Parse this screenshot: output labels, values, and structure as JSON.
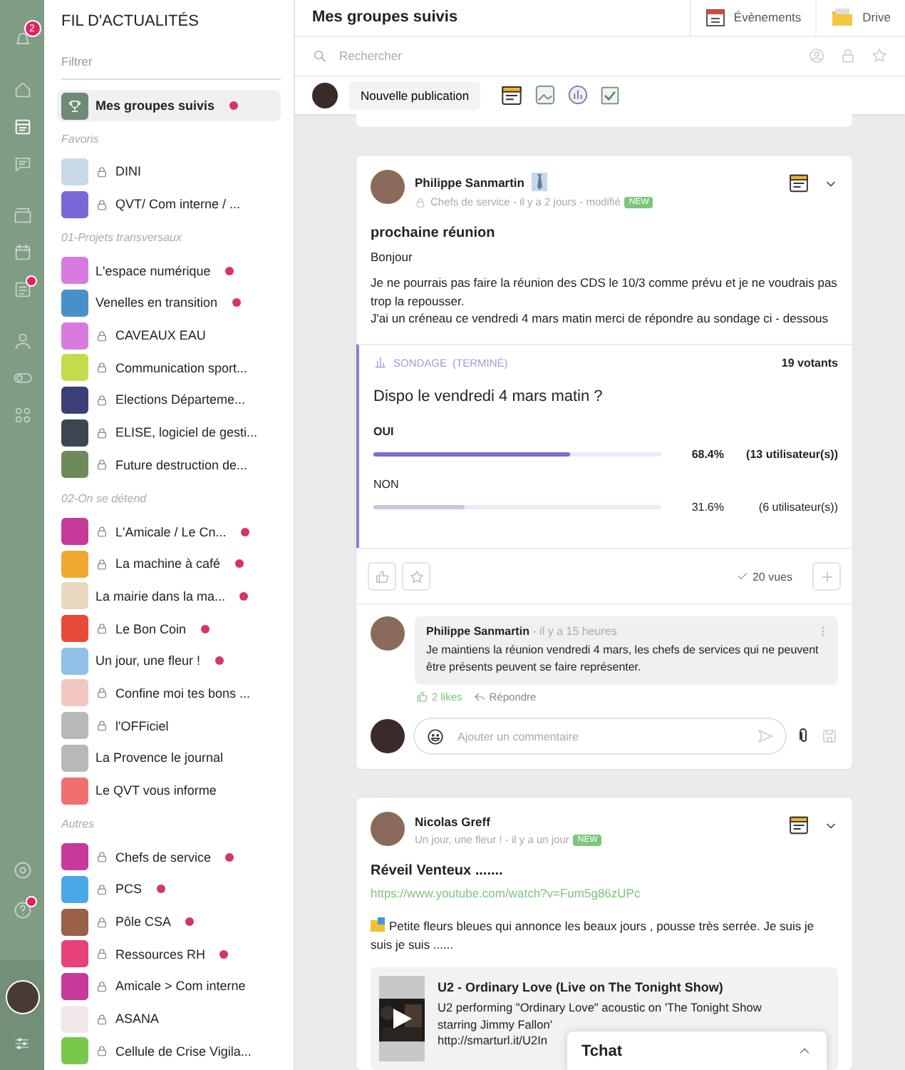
{
  "rail": {
    "groups": [
      [
        {
          "kind": "bell",
          "selected": false,
          "dot": false,
          "badge": "2"
        }
      ],
      [
        {
          "kind": "home",
          "selected": false,
          "dot": false
        },
        {
          "kind": "news",
          "selected": true,
          "dot": false
        },
        {
          "kind": "chat",
          "selected": false,
          "dot": false
        }
      ],
      [
        {
          "kind": "folder",
          "selected": false,
          "dot": false
        },
        {
          "kind": "calendar",
          "selected": false,
          "dot": false
        },
        {
          "kind": "list",
          "selected": false,
          "dot": true
        }
      ],
      [
        {
          "kind": "people",
          "selected": false,
          "dot": false
        },
        {
          "kind": "toggle",
          "selected": false,
          "dot": false
        },
        {
          "kind": "apps",
          "selected": false,
          "dot": false
        }
      ]
    ],
    "bottom": [
      {
        "kind": "settings",
        "selected": false,
        "dot": false
      },
      {
        "kind": "help",
        "selected": false,
        "dot": true
      }
    ]
  },
  "sidebar": {
    "title": "FIL D'ACTUALITÉS",
    "filter": {
      "placeholder": "Filtrer"
    },
    "pinned": {
      "name": "Mes groupes suivis",
      "selected": true,
      "unread": true
    },
    "sections": [
      {
        "label": "Favoris",
        "items": [
          {
            "name": "DINI",
            "locked": true,
            "unread": false,
            "color": "#c9d8e8"
          },
          {
            "name": "QVT/ Com interne / ...",
            "locked": true,
            "unread": false,
            "color": "#7b68d8"
          }
        ]
      },
      {
        "label": "01-Projets transversaux",
        "items": [
          {
            "name": "L'espace numérique",
            "locked": false,
            "unread": true,
            "color": "#d77be0"
          },
          {
            "name": "Venelles en transition",
            "locked": false,
            "unread": true,
            "color": "#4a90c8"
          },
          {
            "name": "CAVEAUX EAU",
            "locked": true,
            "unread": false,
            "color": "#d77be0"
          },
          {
            "name": "Communication sport...",
            "locked": true,
            "unread": false,
            "color": "#c5dc4a"
          },
          {
            "name": "Elections Départeme...",
            "locked": true,
            "unread": false,
            "color": "#3a3f7a"
          },
          {
            "name": "ELISE, logiciel de gesti...",
            "locked": true,
            "unread": false,
            "color": "#3d4650"
          },
          {
            "name": "Future destruction de...",
            "locked": true,
            "unread": false,
            "color": "#6f8a5a"
          }
        ]
      },
      {
        "label": "02-On se détend",
        "items": [
          {
            "name": "L'Amicale / Le Cn...",
            "locked": true,
            "unread": true,
            "color": "#c53a9a"
          },
          {
            "name": "La machine à café",
            "locked": true,
            "unread": true,
            "color": "#f0a830"
          },
          {
            "name": "La mairie dans la ma...",
            "locked": false,
            "unread": true,
            "color": "#e8d8c0"
          },
          {
            "name": "Le Bon Coin",
            "locked": true,
            "unread": true,
            "color": "#e84a3a"
          },
          {
            "name": "Un jour, une fleur !",
            "locked": false,
            "unread": true,
            "color": "#8fc0e8"
          },
          {
            "name": "Confine moi tes bons ...",
            "locked": true,
            "unread": false,
            "color": "#f2c8c0"
          },
          {
            "name": "l'OFFiciel",
            "locked": true,
            "unread": false,
            "color": "#b8b8b8"
          },
          {
            "name": "La Provence le journal",
            "locked": false,
            "unread": false,
            "color": "#b8b8b8"
          },
          {
            "name": "Le QVT vous informe",
            "locked": false,
            "unread": false,
            "color": "#f07070"
          }
        ]
      },
      {
        "label": "Autres",
        "items": [
          {
            "name": "Chefs de service",
            "locked": true,
            "unread": true,
            "color": "#c53a9a"
          },
          {
            "name": "PCS",
            "locked": true,
            "unread": true,
            "color": "#4aa8e8"
          },
          {
            "name": "Pôle CSA",
            "locked": true,
            "unread": true,
            "color": "#9a6048"
          },
          {
            "name": "Ressources RH",
            "locked": true,
            "unread": true,
            "color": "#e8407a"
          },
          {
            "name": "Amicale > Com interne",
            "locked": true,
            "unread": false,
            "color": "#c53a9a"
          },
          {
            "name": "ASANA",
            "locked": true,
            "unread": false,
            "color": "#f0e8e8"
          },
          {
            "name": "Cellule de Crise Vigila...",
            "locked": true,
            "unread": false,
            "color": "#7ac84a"
          }
        ]
      }
    ]
  },
  "header": {
    "title": "Mes groupes suivis",
    "tabs": [
      {
        "label": "Évènements",
        "kind": "calendar"
      },
      {
        "label": "Drive",
        "kind": "folder"
      }
    ]
  },
  "search": {
    "placeholder": "Rechercher"
  },
  "composer": {
    "button": "Nouvelle publication"
  },
  "posts": [
    {
      "author": "Philippe Sanmartin",
      "role_badge": true,
      "locked": true,
      "meta": "Chefs de service - il y a 2 jours - modifié",
      "badge": "NEW",
      "title": "prochaine réunion",
      "paragraphs": [
        "Bonjour",
        "Je ne pourrais pas faire la réunion des CDS le 10/3 comme prévu et je ne voudrais pas trop la repousser.\nJ'ai un créneau ce vendredi 4 mars matin merci de répondre au sondage ci - dessous"
      ],
      "poll": {
        "label": "SONDAGE",
        "status": "(TERMINÉ)",
        "voters": "19 votants",
        "question": "Dispo le vendredi 4 mars matin ?",
        "options": [
          {
            "label": "OUI",
            "level": 0.684,
            "percent": "68.4%",
            "count": "(13 utilisateur(s))",
            "leading": true
          },
          {
            "label": "NON",
            "level": 0.316,
            "percent": "31.6%",
            "count": "(6 utilisateur(s))",
            "leading": false
          }
        ]
      },
      "views": "20 vues",
      "comments": [
        {
          "author": "Philippe Sanmartin",
          "time": "- il y a 15 heures",
          "text": "Je maintiens la réunion vendredi 4 mars, les chefs de services qui ne peuvent être présents peuvent se faire représenter.",
          "likes": "2 likes",
          "reply": "Répondre"
        }
      ],
      "comment_field": {
        "placeholder": "Ajouter un commentaire"
      }
    },
    {
      "author": "Nicolas Greff",
      "role_badge": false,
      "locked": false,
      "meta": "Un jour, une fleur ! - il y a un jour",
      "badge": "NEW",
      "title": "Réveil Venteux .......",
      "link": "https://www.youtube.com/watch?v=Fum5g86zUPc",
      "emoji_paragraph": "Petite fleurs bleues qui annonce les beaux jours , pousse très serrée. Je suis je suis je suis ......",
      "preview": {
        "title": "U2 - Ordinary Love (Live on The Tonight Show)",
        "lines": [
          "U2 performing \"Ordinary Love\" acoustic on 'The Tonight Show",
          "starring Jimmy Fallon'",
          "http://smarturl.it/U2In"
        ]
      }
    }
  ],
  "chat": {
    "title": "Tchat",
    "expanded": false
  }
}
